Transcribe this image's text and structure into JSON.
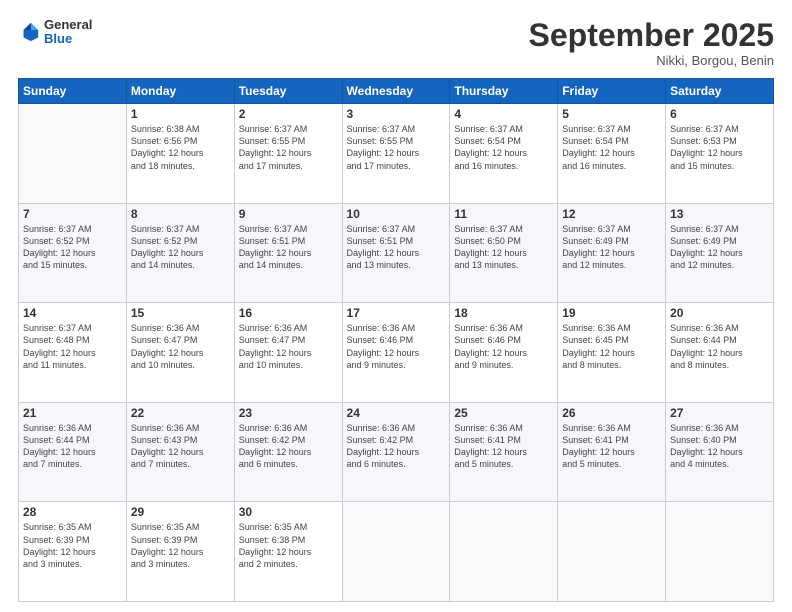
{
  "header": {
    "logo": {
      "line1": "General",
      "line2": "Blue"
    },
    "title": "September 2025",
    "subtitle": "Nikki, Borgou, Benin"
  },
  "weekdays": [
    "Sunday",
    "Monday",
    "Tuesday",
    "Wednesday",
    "Thursday",
    "Friday",
    "Saturday"
  ],
  "weeks": [
    [
      {
        "day": "",
        "info": ""
      },
      {
        "day": "1",
        "info": "Sunrise: 6:38 AM\nSunset: 6:56 PM\nDaylight: 12 hours\nand 18 minutes."
      },
      {
        "day": "2",
        "info": "Sunrise: 6:37 AM\nSunset: 6:55 PM\nDaylight: 12 hours\nand 17 minutes."
      },
      {
        "day": "3",
        "info": "Sunrise: 6:37 AM\nSunset: 6:55 PM\nDaylight: 12 hours\nand 17 minutes."
      },
      {
        "day": "4",
        "info": "Sunrise: 6:37 AM\nSunset: 6:54 PM\nDaylight: 12 hours\nand 16 minutes."
      },
      {
        "day": "5",
        "info": "Sunrise: 6:37 AM\nSunset: 6:54 PM\nDaylight: 12 hours\nand 16 minutes."
      },
      {
        "day": "6",
        "info": "Sunrise: 6:37 AM\nSunset: 6:53 PM\nDaylight: 12 hours\nand 15 minutes."
      }
    ],
    [
      {
        "day": "7",
        "info": "Sunrise: 6:37 AM\nSunset: 6:52 PM\nDaylight: 12 hours\nand 15 minutes."
      },
      {
        "day": "8",
        "info": "Sunrise: 6:37 AM\nSunset: 6:52 PM\nDaylight: 12 hours\nand 14 minutes."
      },
      {
        "day": "9",
        "info": "Sunrise: 6:37 AM\nSunset: 6:51 PM\nDaylight: 12 hours\nand 14 minutes."
      },
      {
        "day": "10",
        "info": "Sunrise: 6:37 AM\nSunset: 6:51 PM\nDaylight: 12 hours\nand 13 minutes."
      },
      {
        "day": "11",
        "info": "Sunrise: 6:37 AM\nSunset: 6:50 PM\nDaylight: 12 hours\nand 13 minutes."
      },
      {
        "day": "12",
        "info": "Sunrise: 6:37 AM\nSunset: 6:49 PM\nDaylight: 12 hours\nand 12 minutes."
      },
      {
        "day": "13",
        "info": "Sunrise: 6:37 AM\nSunset: 6:49 PM\nDaylight: 12 hours\nand 12 minutes."
      }
    ],
    [
      {
        "day": "14",
        "info": "Sunrise: 6:37 AM\nSunset: 6:48 PM\nDaylight: 12 hours\nand 11 minutes."
      },
      {
        "day": "15",
        "info": "Sunrise: 6:36 AM\nSunset: 6:47 PM\nDaylight: 12 hours\nand 10 minutes."
      },
      {
        "day": "16",
        "info": "Sunrise: 6:36 AM\nSunset: 6:47 PM\nDaylight: 12 hours\nand 10 minutes."
      },
      {
        "day": "17",
        "info": "Sunrise: 6:36 AM\nSunset: 6:46 PM\nDaylight: 12 hours\nand 9 minutes."
      },
      {
        "day": "18",
        "info": "Sunrise: 6:36 AM\nSunset: 6:46 PM\nDaylight: 12 hours\nand 9 minutes."
      },
      {
        "day": "19",
        "info": "Sunrise: 6:36 AM\nSunset: 6:45 PM\nDaylight: 12 hours\nand 8 minutes."
      },
      {
        "day": "20",
        "info": "Sunrise: 6:36 AM\nSunset: 6:44 PM\nDaylight: 12 hours\nand 8 minutes."
      }
    ],
    [
      {
        "day": "21",
        "info": "Sunrise: 6:36 AM\nSunset: 6:44 PM\nDaylight: 12 hours\nand 7 minutes."
      },
      {
        "day": "22",
        "info": "Sunrise: 6:36 AM\nSunset: 6:43 PM\nDaylight: 12 hours\nand 7 minutes."
      },
      {
        "day": "23",
        "info": "Sunrise: 6:36 AM\nSunset: 6:42 PM\nDaylight: 12 hours\nand 6 minutes."
      },
      {
        "day": "24",
        "info": "Sunrise: 6:36 AM\nSunset: 6:42 PM\nDaylight: 12 hours\nand 6 minutes."
      },
      {
        "day": "25",
        "info": "Sunrise: 6:36 AM\nSunset: 6:41 PM\nDaylight: 12 hours\nand 5 minutes."
      },
      {
        "day": "26",
        "info": "Sunrise: 6:36 AM\nSunset: 6:41 PM\nDaylight: 12 hours\nand 5 minutes."
      },
      {
        "day": "27",
        "info": "Sunrise: 6:36 AM\nSunset: 6:40 PM\nDaylight: 12 hours\nand 4 minutes."
      }
    ],
    [
      {
        "day": "28",
        "info": "Sunrise: 6:35 AM\nSunset: 6:39 PM\nDaylight: 12 hours\nand 3 minutes."
      },
      {
        "day": "29",
        "info": "Sunrise: 6:35 AM\nSunset: 6:39 PM\nDaylight: 12 hours\nand 3 minutes."
      },
      {
        "day": "30",
        "info": "Sunrise: 6:35 AM\nSunset: 6:38 PM\nDaylight: 12 hours\nand 2 minutes."
      },
      {
        "day": "",
        "info": ""
      },
      {
        "day": "",
        "info": ""
      },
      {
        "day": "",
        "info": ""
      },
      {
        "day": "",
        "info": ""
      }
    ]
  ]
}
